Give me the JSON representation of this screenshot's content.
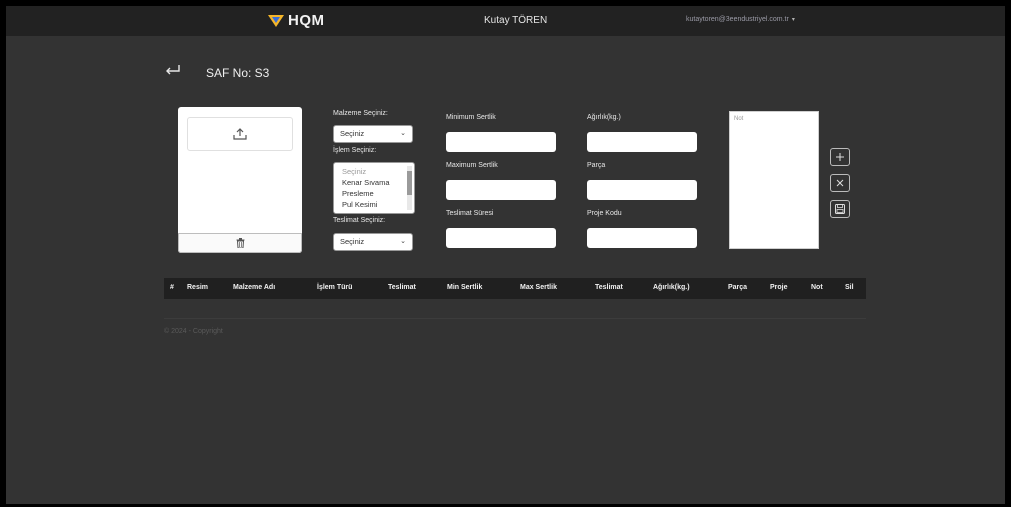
{
  "header": {
    "logo_text": "HQM",
    "logo_color": "#f5b62a",
    "user_name": "Kutay TÖREN",
    "user_email": "kutaytoren@3eendustriyel.com.tr",
    "email_caret": "▾"
  },
  "page": {
    "title": "SAF No: S3"
  },
  "form": {
    "malzeme_label": "Malzeme Seçiniz:",
    "malzeme_value": "Seçiniz",
    "islem_label": "İşlem Seçiniz:",
    "islem_options": [
      "Seçiniz",
      "Kenar Sıvama",
      "Presleme",
      "Pul Kesimi"
    ],
    "teslimat_label": "Teslimat Seçiniz:",
    "teslimat_value": "Seçiniz",
    "min_sertlik_label": "Minimum Sertlik",
    "max_sertlik_label": "Maximum Sertlik",
    "teslimat_suresi_label": "Teslimat Süresi",
    "agirlik_label": "Ağırlık(kg.)",
    "parca_label": "Parça",
    "proje_kodu_label": "Proje Kodu",
    "note_placeholder": "Not"
  },
  "table": {
    "columns": [
      "#",
      "Resim",
      "Malzeme Adı",
      "İşlem Türü",
      "Teslimat",
      "Min Sertlik",
      "Max Sertlik",
      "Teslimat",
      "Ağırlık(kg.)",
      "Parça",
      "Proje",
      "Not",
      "Sil"
    ],
    "rows": []
  },
  "footer": {
    "text": "© 2024 - Copyright"
  },
  "icons": {
    "back": "return-arrow-icon",
    "upload": "upload-icon",
    "trash": "trash-icon",
    "add": "plus-icon",
    "clear": "close-icon",
    "save": "save-icon"
  }
}
